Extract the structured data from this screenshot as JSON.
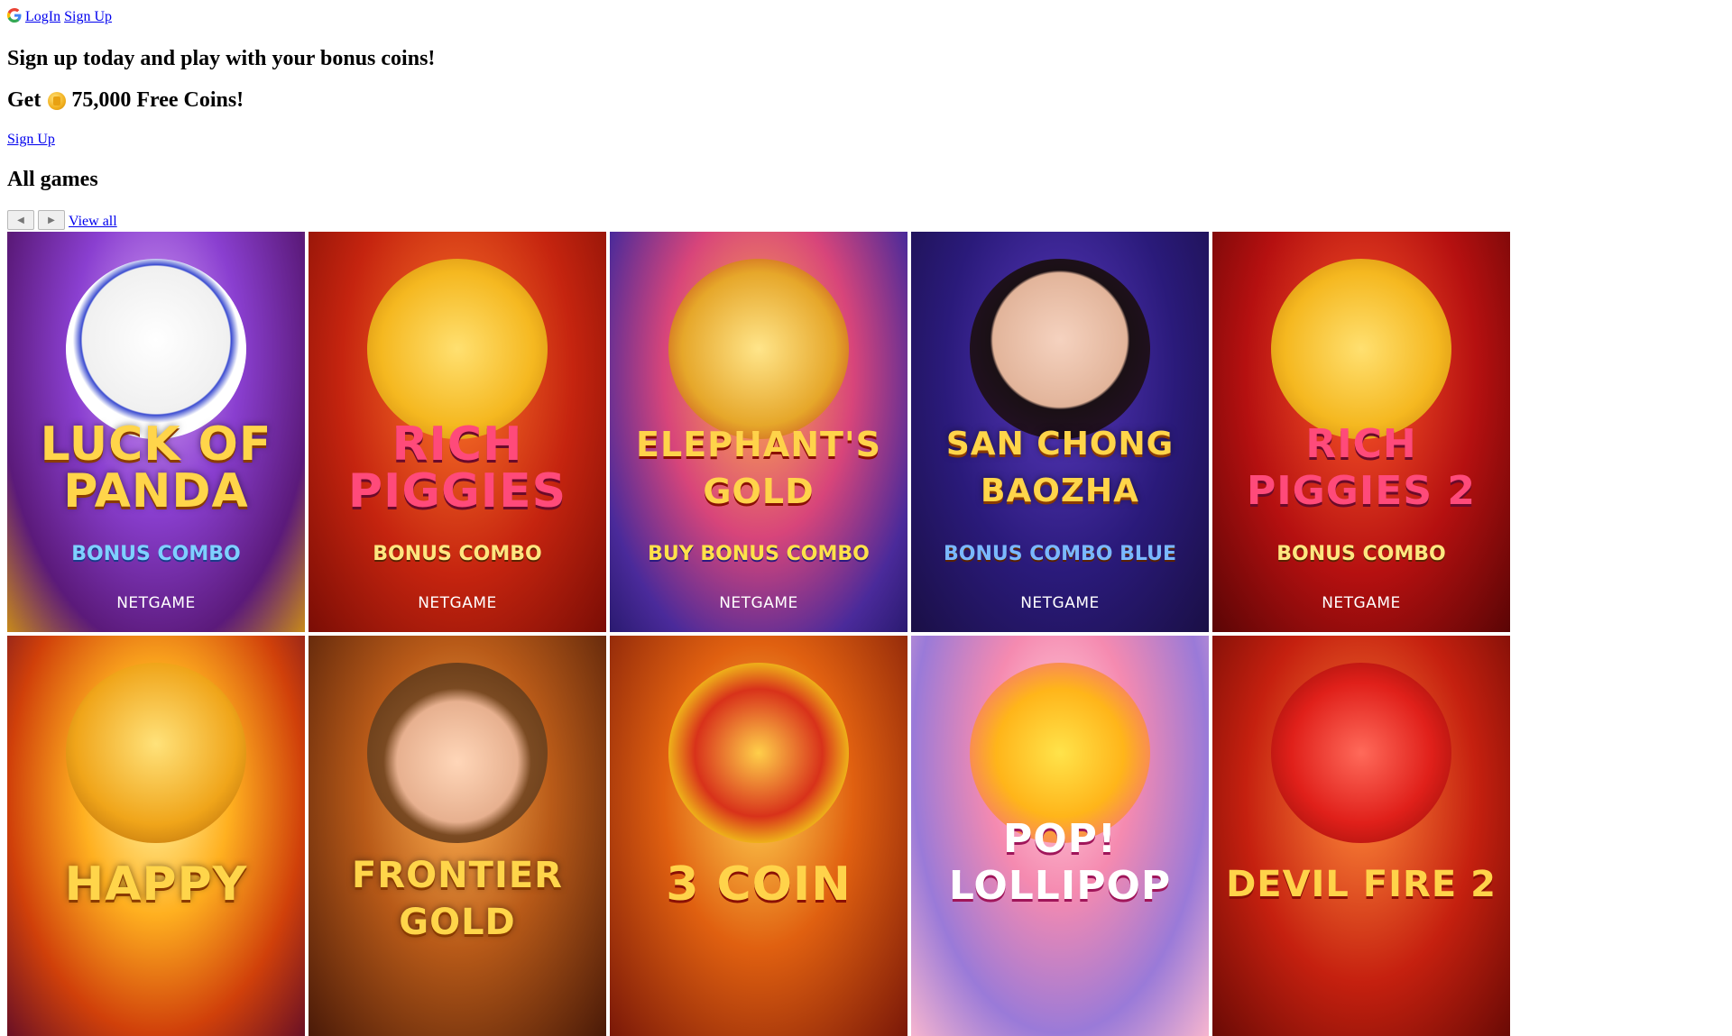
{
  "header": {
    "login_label": "LogIn",
    "signup_label": "Sign Up",
    "google_icon": "google-icon"
  },
  "promo": {
    "headline": "Sign up today and play with your bonus coins!",
    "coins_prefix": "Get",
    "coins_text": "75,000 Free Coins!",
    "coin_icon": "coin-icon",
    "signup_link": "Sign Up"
  },
  "games_section": {
    "title": "All games",
    "prev_icon": "arrow-left-icon",
    "next_icon": "arrow-right-icon",
    "view_all": "View all",
    "tiles": [
      {
        "title": "LUCK OF PANDA",
        "subtitle": "BONUS COMBO",
        "provider": "NETGAME"
      },
      {
        "title": "RICH PIGGIES",
        "subtitle": "BONUS COMBO",
        "provider": "NETGAME"
      },
      {
        "title": "ELEPHANT'S GOLD",
        "subtitle": "BUY BONUS COMBO",
        "provider": "NETGAME"
      },
      {
        "title": "SAN CHONG BAOZHA",
        "subtitle": "BONUS COMBO BLUE",
        "provider": "NETGAME"
      },
      {
        "title": "RICH PIGGIES 2",
        "subtitle": "BONUS COMBO",
        "provider": "NETGAME"
      },
      {
        "title": "HAPPY",
        "subtitle": "",
        "provider": ""
      },
      {
        "title": "FRONTIER GOLD",
        "subtitle": "",
        "provider": ""
      },
      {
        "title": "3 COIN",
        "subtitle": "",
        "provider": ""
      },
      {
        "title": "POP! LOLLIPOP",
        "subtitle": "",
        "provider": ""
      },
      {
        "title": "DEVIL FIRE 2",
        "subtitle": "",
        "provider": ""
      }
    ]
  }
}
